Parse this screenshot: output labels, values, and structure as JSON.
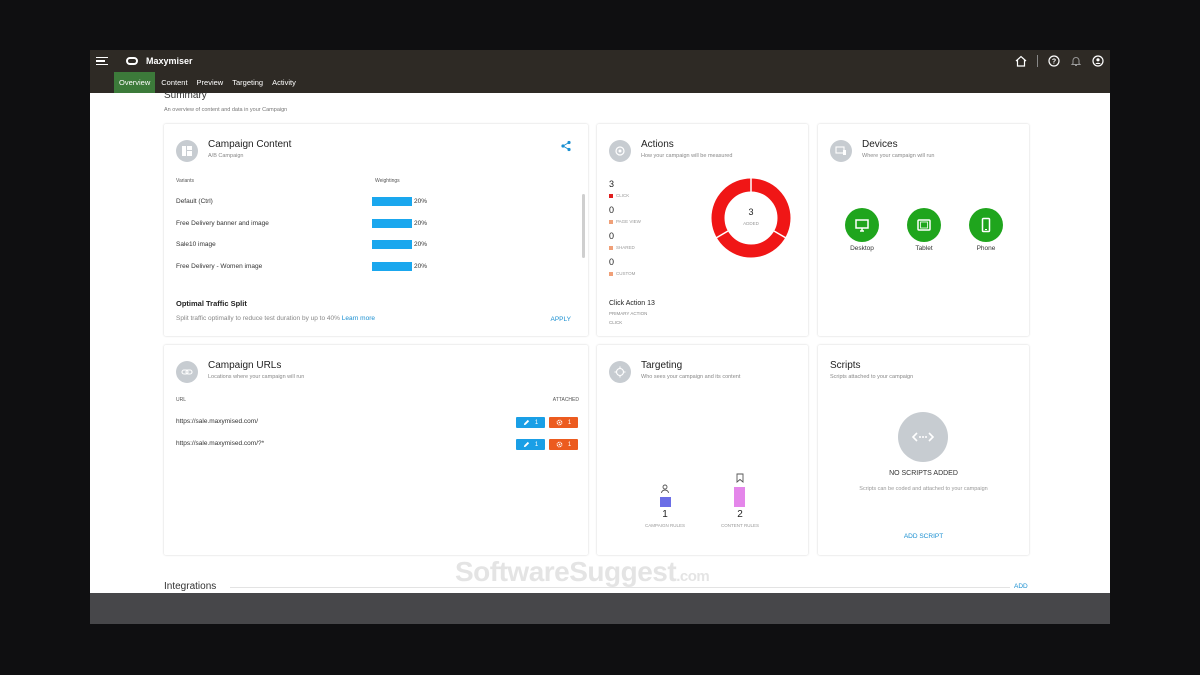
{
  "app": {
    "title": "Maxymiser"
  },
  "nav": {
    "tabs": [
      "Overview",
      "Content",
      "Preview",
      "Targeting",
      "Activity"
    ]
  },
  "summary": {
    "title": "Summary",
    "subtitle": "An overview of content and data in your Campaign"
  },
  "campaign_content": {
    "title": "Campaign Content",
    "subtitle": "A/B Campaign",
    "col_variants": "Variants",
    "col_weightings": "Weightings",
    "variants": [
      {
        "name": "Default (Ctrl)",
        "weight": "20%"
      },
      {
        "name": "Free Delivery banner and image",
        "weight": "20%"
      },
      {
        "name": "Sale10 image",
        "weight": "20%"
      },
      {
        "name": "Free Delivery - Women image",
        "weight": "20%"
      }
    ],
    "optimal_title": "Optimal Traffic Split",
    "optimal_text": "Split traffic optimally to reduce test duration by up to 40%",
    "learn_more": "Learn more",
    "apply": "APPLY"
  },
  "actions": {
    "title": "Actions",
    "subtitle": "How your campaign will be measured",
    "items": [
      {
        "count": "3",
        "label": "CLICK",
        "color": "#e01e1e"
      },
      {
        "count": "0",
        "label": "PAGE VIEW",
        "color": "#f0a078"
      },
      {
        "count": "0",
        "label": "SHARED",
        "color": "#f0a078"
      },
      {
        "count": "0",
        "label": "CUSTOM",
        "color": "#f0a078"
      }
    ],
    "donut_value": "3",
    "donut_label": "ADDED",
    "donut_color": "#f01616",
    "primary_name": "Click Action 13",
    "primary_label": "PRIMARY ACTION",
    "primary_type": "CLICK"
  },
  "devices": {
    "title": "Devices",
    "subtitle": "Where your campaign will run",
    "items": [
      "Desktop",
      "Tablet",
      "Phone"
    ]
  },
  "campaign_urls": {
    "title": "Campaign URLs",
    "subtitle": "Locations where your campaign will run",
    "col_url": "URL",
    "col_attached": "ATTACHED",
    "rows": [
      {
        "url": "https://sale.maxymised.com/",
        "edits": "1",
        "scripts": "1"
      },
      {
        "url": "https://sale.maxymised.com/?*",
        "edits": "1",
        "scripts": "1"
      }
    ]
  },
  "targeting": {
    "title": "Targeting",
    "subtitle": "Who sees your campaign and its content",
    "campaign_rules_count": "1",
    "campaign_rules_label": "CAMPAIGN RULES",
    "content_rules_count": "2",
    "content_rules_label": "CONTENT RULES"
  },
  "scripts": {
    "title": "Scripts",
    "subtitle": "Scripts attached to your campaign",
    "empty_title": "NO SCRIPTS ADDED",
    "empty_text": "Scripts can be coded and attached to your campaign",
    "add": "ADD SCRIPT"
  },
  "integrations": {
    "title": "Integrations",
    "add": "ADD"
  },
  "watermark": {
    "main": "SoftwareSuggest",
    "suffix": ".com"
  }
}
